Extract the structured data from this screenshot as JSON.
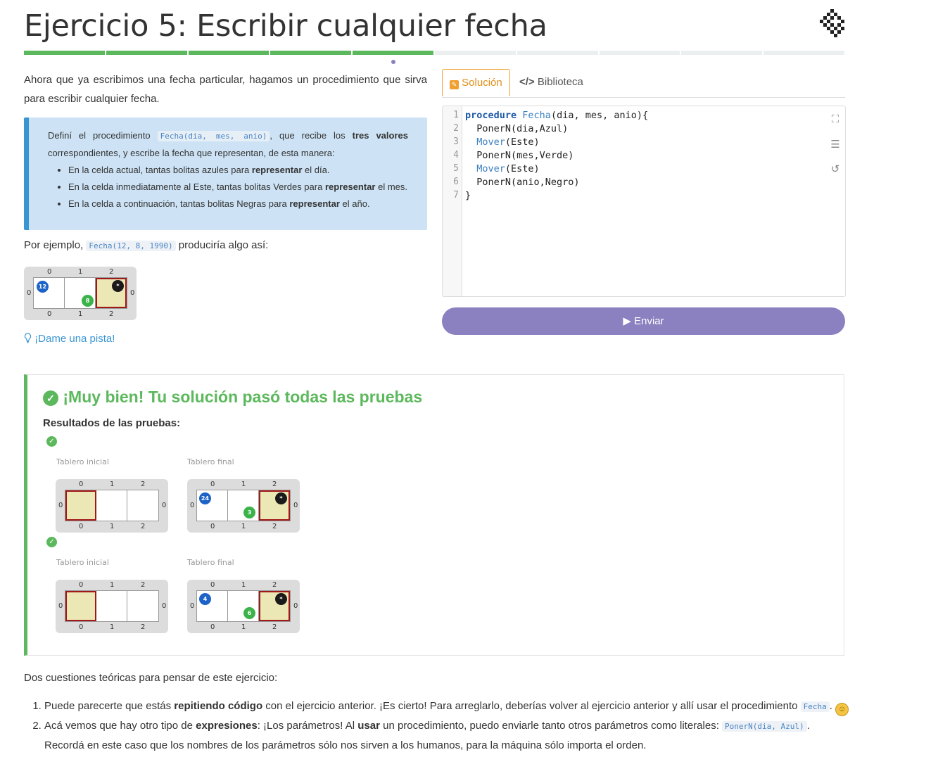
{
  "header": {
    "title": "Ejercicio 5: Escribir cualquier fecha",
    "progress_done": 5,
    "progress_total": 10
  },
  "intro": "Ahora que ya escribimos una fecha particular, hagamos un procedimiento que sirva para escribir cualquier fecha.",
  "callout": {
    "p1": "Definí el procedimiento",
    "code": "Fecha(dia, mes, anio)",
    "p2": ", que recibe los",
    "bold": "tres valores",
    "p3": "correspondientes, y escribe la fecha que representan, de esta manera:",
    "items": [
      {
        "a": "En la celda actual, tantas bolitas azules para ",
        "b": "representar",
        "c": " el día."
      },
      {
        "a": "En la celda inmediatamente al Este, tantas bolitas Verdes para ",
        "b": "representar",
        "c": " el mes."
      },
      {
        "a": "En la celda a continuación, tantas bolitas Negras para ",
        "b": "representar",
        "c": " el año."
      }
    ]
  },
  "example": {
    "pre": "Por ejemplo,",
    "code": "Fecha(12, 8, 1990)",
    "post": "produciría algo así:",
    "blue": "12",
    "green": "8",
    "black": "*"
  },
  "hint": "¡Dame una pista!",
  "tabs": {
    "solution": "Solución",
    "library": "Biblioteca"
  },
  "editor": {
    "line_numbers": [
      "1",
      "2",
      "3",
      "4",
      "5",
      "6",
      "7"
    ]
  },
  "submit_label": "Enviar",
  "result": {
    "title": "¡Muy bien! Tu solución pasó todas las pruebas",
    "subtitle": "Resultados de las pruebas:",
    "initial_label": "Tablero inicial",
    "final_label": "Tablero final",
    "tests": [
      {
        "blue": "24",
        "green": "3",
        "black": "*"
      },
      {
        "blue": "4",
        "green": "6",
        "black": "*"
      }
    ]
  },
  "board_labels": {
    "c0": "0",
    "c1": "1",
    "c2": "2",
    "r0": "0"
  },
  "footer": {
    "intro": "Dos cuestiones teóricas para pensar de este ejercicio:",
    "i1a": "Puede parecerte que estás ",
    "i1b": "repitiendo código",
    "i1c": " con el ejercicio anterior. ¡Es cierto! Para arreglarlo, deberías volver al ejercicio anterior y allí usar el procedimiento ",
    "i1code": "Fecha",
    "i2a": "Acá vemos que hay otro tipo de ",
    "i2b": "expresiones",
    "i2c": ": ¡Los parámetros! Al ",
    "i2d": "usar",
    "i2e": " un procedimiento, puedo enviarle tanto otros parámetros como literales: ",
    "i2code": "PonerN(dia, Azul)",
    "i2f": "Recordá en este caso que los nombres de los parámetros sólo nos sirven a los humanos, para la máquina sólo importa el orden."
  },
  "colors": {
    "accent": "#8b80c0",
    "success": "#5cb85c",
    "info": "#3a95d3",
    "tab_active": "#f0a030"
  },
  "icons": [
    "logo-icon",
    "lightbulb-icon",
    "edit-icon",
    "code-icon",
    "fullscreen-icon",
    "indent-icon",
    "reset-icon",
    "play-icon",
    "check-circle-icon"
  ]
}
